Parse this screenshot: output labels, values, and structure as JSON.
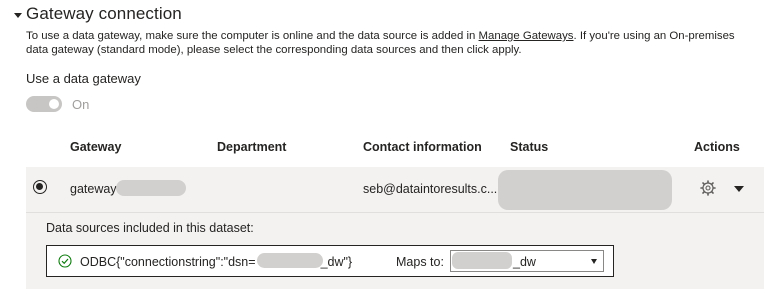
{
  "section": {
    "title": "Gateway connection",
    "description_pre": "To use a data gateway, make sure the computer is online and the data source is added in ",
    "description_link": "Manage Gateways",
    "description_post": ". If you're using an On-premises data gateway (standard mode), please select the corresponding data sources and then click apply."
  },
  "use_gateway": {
    "label": "Use a data gateway",
    "toggle_state": "On",
    "toggle_on": true
  },
  "table": {
    "headers": {
      "gateway": "Gateway",
      "department": "Department",
      "contact": "Contact information",
      "status": "Status",
      "actions": "Actions"
    },
    "row": {
      "selected": true,
      "gateway_name": "gateway",
      "contact": "seb@dataintoresults.c...",
      "actions_icons": [
        "gear-icon",
        "chevron-down-icon"
      ]
    }
  },
  "data_sources": {
    "label": "Data sources included in this dataset:",
    "items": [
      {
        "status_icon": "check-circle-icon",
        "name_pre": "ODBC{\"connectionstring\":\"dsn=",
        "name_post": "_dw\"}",
        "maps_label": "Maps to:",
        "maps_value": "_dw"
      }
    ]
  },
  "colors": {
    "accent_gray": "#c8c6c4",
    "row_bg": "#f3f2f1",
    "check_green": "#107c10",
    "text": "#252423"
  }
}
